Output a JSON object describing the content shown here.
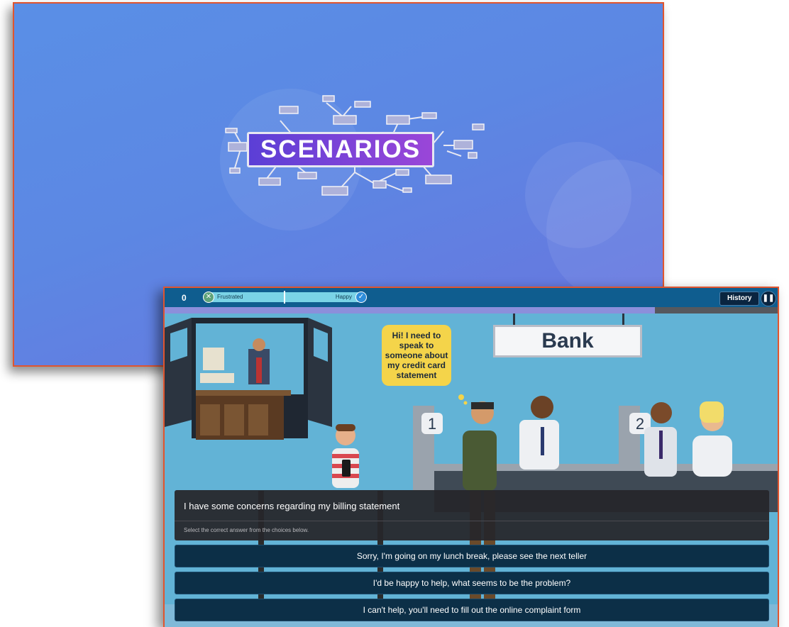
{
  "title_slide": {
    "title": "SCENARIOS"
  },
  "player": {
    "score": "0",
    "mood_meter": {
      "left_label": "Frustrated",
      "right_label": "Happy",
      "level": 0.5
    },
    "history_label": "History",
    "progress_fraction": 0.8
  },
  "scene": {
    "speech_bubble": "Hi! I need to speak to someone about my credit card statement",
    "bank_sign": "Bank",
    "counter_1": "1",
    "counter_2": "2"
  },
  "question": {
    "prompt": "I have some concerns regarding my billing statement",
    "instruction": "Select the correct answer from the choices below."
  },
  "choices": [
    "Sorry, I'm going on my lunch break, please see the next teller",
    "I'd be happy to help, what seems to be the problem?",
    "I can't help, you'll need to fill out the online complaint form"
  ],
  "colors": {
    "slide_border": "#e0552f",
    "title_gradient_start": "#5b3fd6",
    "title_gradient_end": "#9a46d8",
    "topbar": "#0f5d8f",
    "choice_bg": "#0c2f47",
    "bubble": "#f4d44a"
  },
  "icons": [
    "x-icon",
    "check-icon",
    "pause-icon"
  ]
}
